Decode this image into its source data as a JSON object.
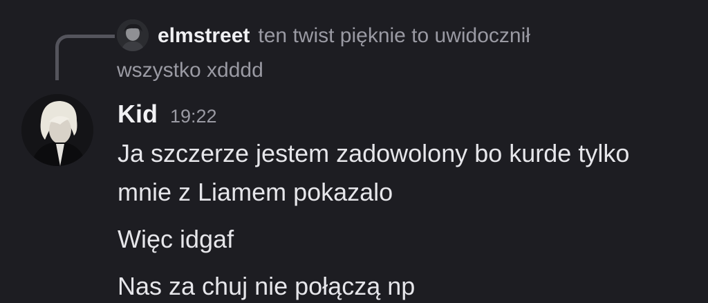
{
  "reply": {
    "author": "elmstreet",
    "preview_line1": "ten twist pięknie to uwidocznił",
    "preview_line2": "wszystko xdddd"
  },
  "message": {
    "author": "Kid",
    "timestamp": "19:22",
    "lines": [
      "Ja szczerze jestem zadowolony bo kurde tylko",
      "mnie z Liamem pokazalo",
      "Więc idgaf",
      "Nas za chuj nie połączą np"
    ]
  },
  "colors": {
    "background": "#1d1d22",
    "text": "#e6e6ea",
    "muted": "#9a9aa3",
    "reply_spine": "#54545c"
  }
}
